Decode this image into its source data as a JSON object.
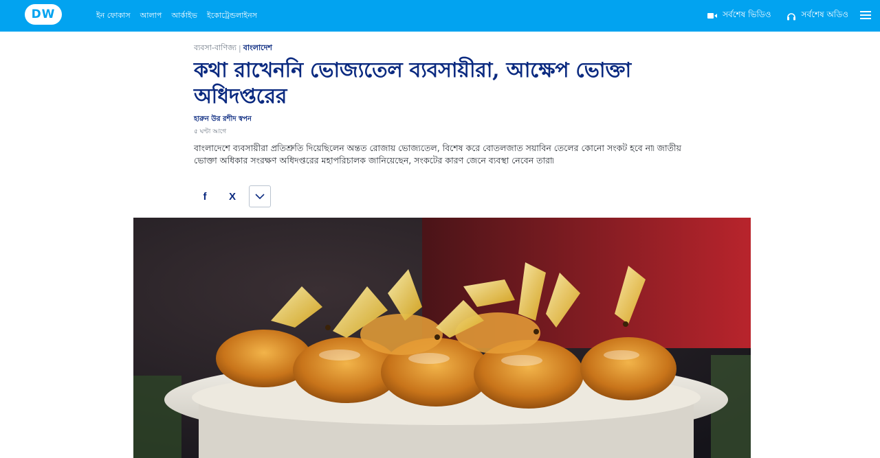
{
  "header": {
    "logo_text": "DW",
    "nav": [
      "ইন ফোকাস",
      "আলাপ",
      "আর্কাইভ",
      "ইকোট্রেন্ডলাইনস"
    ],
    "latest_video": "সর্বশেষ ভিডিও",
    "latest_audio": "সর্বশেষ অডিও",
    "brand_color": "#02a3f0"
  },
  "article": {
    "breadcrumb_section": "ব্যবসা-বাণিজ্য",
    "breadcrumb_sep": "|",
    "breadcrumb_category": "বাংলাদেশ",
    "title": "কথা রাখেননি ভোজ্যতেল ব্যবসায়ীরা, আক্ষেপ ভোক্তা অধিদপ্তরের",
    "author": "হারুন উর রশীদ স্বপন",
    "time": "৫ ঘণ্টা আগে",
    "lead": "বাংলাদেশে ব্যবসায়ীরা প্রতিশ্রুতি দিয়েছিলেন অন্তত রোজায় ভোজ্যতেল, বিশেষ করে বোতলজাত সয়াবিন তেলের কোনো সংকট হবে না৷ জাতীয় ভোক্তা অধিকার সংরক্ষণ অধিদপ্তরের মহাপরিচালক জানিয়েছেন, সংকটের কারণ জেনে ব্যবস্থা নেবেন তারা৷",
    "title_color": "#0b2a80"
  },
  "share": {
    "facebook_label": "f",
    "x_label": "X",
    "more_icon": "chevron-down-icon"
  },
  "hero_image": {
    "description_icon": "oil-packets-photo"
  }
}
